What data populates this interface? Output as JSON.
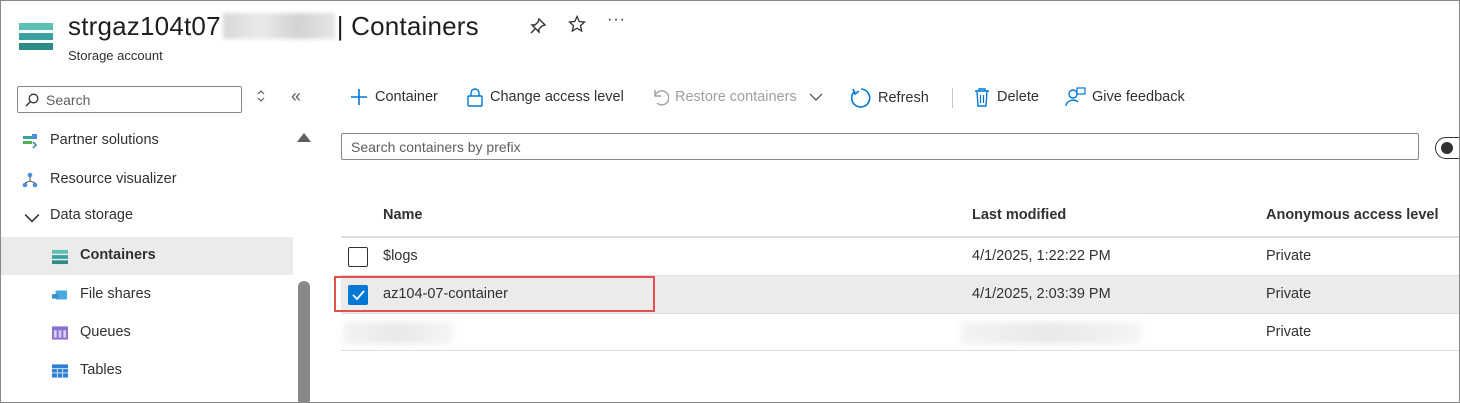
{
  "header": {
    "title_prefix": "strgaz104t07",
    "title_suffix": "| Containers",
    "subtitle": "Storage account",
    "actions": [
      {
        "name": "pin-icon",
        "glyph": "📌"
      },
      {
        "name": "star-icon",
        "glyph": "☆"
      },
      {
        "name": "more-icon",
        "glyph": "···"
      }
    ]
  },
  "sidebar": {
    "search_placeholder": "Search",
    "items": [
      {
        "label": "Partner solutions",
        "icon": "partner-icon"
      },
      {
        "label": "Resource visualizer",
        "icon": "visualizer-icon"
      },
      {
        "label": "Data storage",
        "icon": "chevron-down-icon"
      },
      {
        "label": "Containers",
        "icon": "containers-icon",
        "selected": true
      },
      {
        "label": "File shares",
        "icon": "file-shares-icon"
      },
      {
        "label": "Queues",
        "icon": "queues-icon"
      },
      {
        "label": "Tables",
        "icon": "tables-icon"
      }
    ]
  },
  "toolbar": {
    "add_container": "Container",
    "change_access": "Change access level",
    "restore": "Restore containers",
    "refresh": "Refresh",
    "delete": "Delete",
    "feedback": "Give feedback"
  },
  "filter": {
    "placeholder": "Search containers by prefix"
  },
  "grid": {
    "columns": [
      "Name",
      "Last modified",
      "Anonymous access level"
    ],
    "rows": [
      {
        "name": "$logs",
        "modified": "4/1/2025, 1:22:22 PM",
        "access": "Private",
        "checked": false
      },
      {
        "name": "az104-07-container",
        "modified": "4/1/2025, 2:03:39 PM",
        "access": "Private",
        "checked": true
      },
      {
        "name": "",
        "modified": "",
        "access": "Private",
        "checked": false
      }
    ]
  },
  "colors": {
    "accent": "#0078d4",
    "highlight": "#e05050",
    "selected_bg": "#edebe9"
  }
}
